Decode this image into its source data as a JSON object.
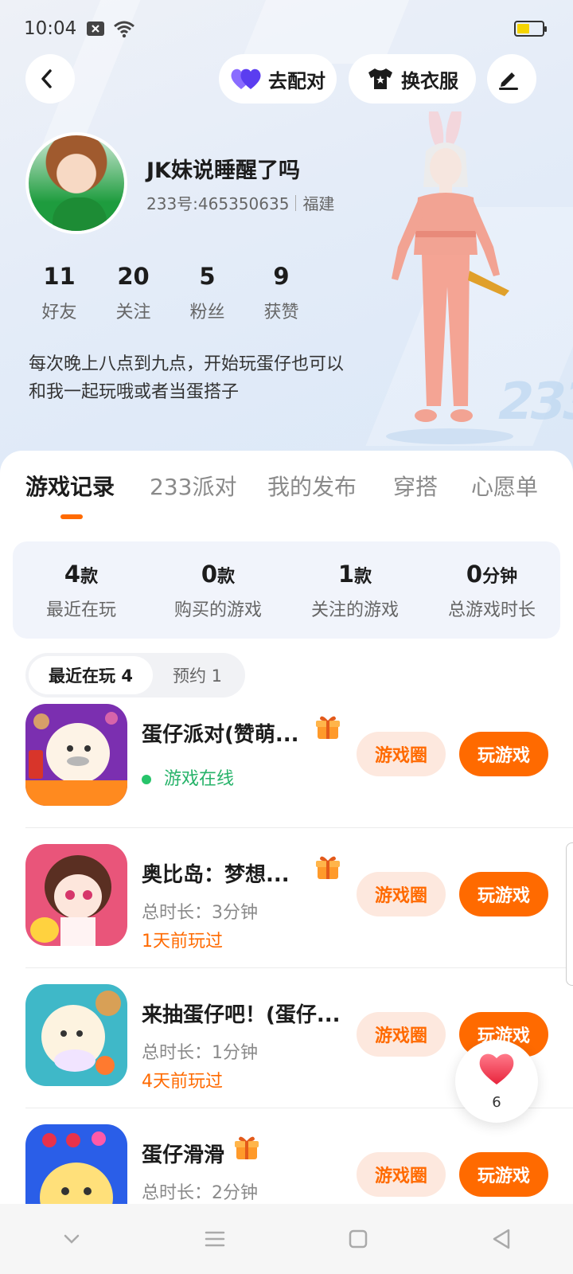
{
  "status_bar": {
    "time": "10:04"
  },
  "header": {
    "back_icon": "chevron-left-icon",
    "match_label": "去配对",
    "outfit_label": "换衣服",
    "edit_icon": "pen-icon"
  },
  "profile": {
    "nickname": "JK妹说睡醒了吗",
    "uid": "233号:465350635",
    "region": "福建",
    "stats": [
      {
        "num": "11",
        "label": "好友"
      },
      {
        "num": "20",
        "label": "关注"
      },
      {
        "num": "5",
        "label": "粉丝"
      },
      {
        "num": "9",
        "label": "获赞"
      }
    ],
    "bio_line1": "每次晚上八点到九点，开始玩蛋仔也可以",
    "bio_line2": "和我一起玩哦或者当蛋搭子",
    "watermark": "233"
  },
  "tabs": [
    "游戏记录",
    "233派对",
    "我的发布",
    "穿搭",
    "心愿单"
  ],
  "summary": [
    {
      "value": "4",
      "unit": "款",
      "label": "最近在玩"
    },
    {
      "value": "0",
      "unit": "款",
      "label": "购买的游戏"
    },
    {
      "value": "1",
      "unit": "款",
      "label": "关注的游戏"
    },
    {
      "value": "0",
      "unit": "分钟",
      "label": "总游戏时长"
    }
  ],
  "segment": {
    "active": "最近在玩 4",
    "inactive": "预约 1"
  },
  "games": [
    {
      "name": "蛋仔派对(赞萌...",
      "status": "游戏在线",
      "circle": "游戏圈",
      "play": "玩游戏"
    },
    {
      "name": "奥比岛：梦想...",
      "duration": "总时长：3分钟",
      "last_played": "1天前玩过",
      "circle": "游戏圈",
      "play": "玩游戏"
    },
    {
      "name": "来抽蛋仔吧！(蛋仔...",
      "duration": "总时长：1分钟",
      "last_played": "4天前玩过",
      "circle": "游戏圈",
      "play": "玩游戏"
    },
    {
      "name": "蛋仔滑滑",
      "duration": "总时长：2分钟",
      "circle": "游戏圈",
      "play": "玩游戏"
    }
  ],
  "like_float": {
    "count": "6"
  },
  "colors": {
    "accent": "#ff6a00",
    "accent_soft": "#fde8de",
    "online": "#27c46a",
    "summary_bg": "#f1f4fb"
  }
}
